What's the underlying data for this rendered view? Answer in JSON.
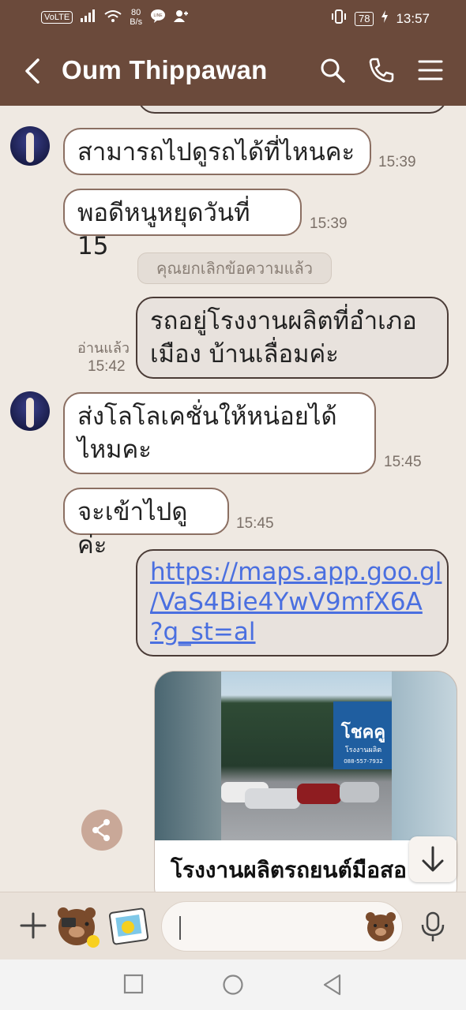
{
  "status_bar": {
    "volte": "VoLTE",
    "net_speed_value": "80",
    "net_speed_unit": "B/s",
    "line_badge": "LINE",
    "battery": "78",
    "time": "13:57"
  },
  "header": {
    "contact_name": "Oum Thippawan",
    "icons": [
      "back-icon",
      "search-icon",
      "phone-icon",
      "menu-icon"
    ]
  },
  "messages": [
    {
      "sender": "them",
      "text": "สามารถไปดูรถได้ที่ไหนคะ",
      "time": "15:39"
    },
    {
      "sender": "them",
      "text": "พอดีหนูหยุดวันที่ 15",
      "time": "15:39"
    },
    {
      "sender": "system",
      "text": "คุณยกเลิกข้อความแล้ว"
    },
    {
      "sender": "me",
      "line1": "รถอยู่โรงงานผลิตที่อำเภอ",
      "line2": "เมือง บ้านเลื่อมค่ะ",
      "read": "อ่านแล้ว",
      "time": "15:42"
    },
    {
      "sender": "them",
      "line1": "ส่งโลโลเคชั่นให้หน่อยได้",
      "line2": "ไหมคะ",
      "time": "15:45"
    },
    {
      "sender": "them",
      "text": "จะเข้าไปดูค่ะ",
      "time": "15:45"
    },
    {
      "sender": "me",
      "link_line1": "https://maps.app.goo.gl",
      "link_line2": "/VaS4Bie4YwV9mfX6A",
      "link_line3": "?g_st=al"
    }
  ],
  "link_preview": {
    "title": "โรงงานผลิตรถยนต์มือสอ",
    "sign_text": "โชคคู",
    "sign_sub": "โรงงานผลิต",
    "sign_phone": "088-557-7932"
  },
  "colors": {
    "header_bg": "#6b4a3b",
    "chat_bg": "#efe9e2",
    "link": "#4a6fe0",
    "bubble_border": "#8b6f62"
  }
}
